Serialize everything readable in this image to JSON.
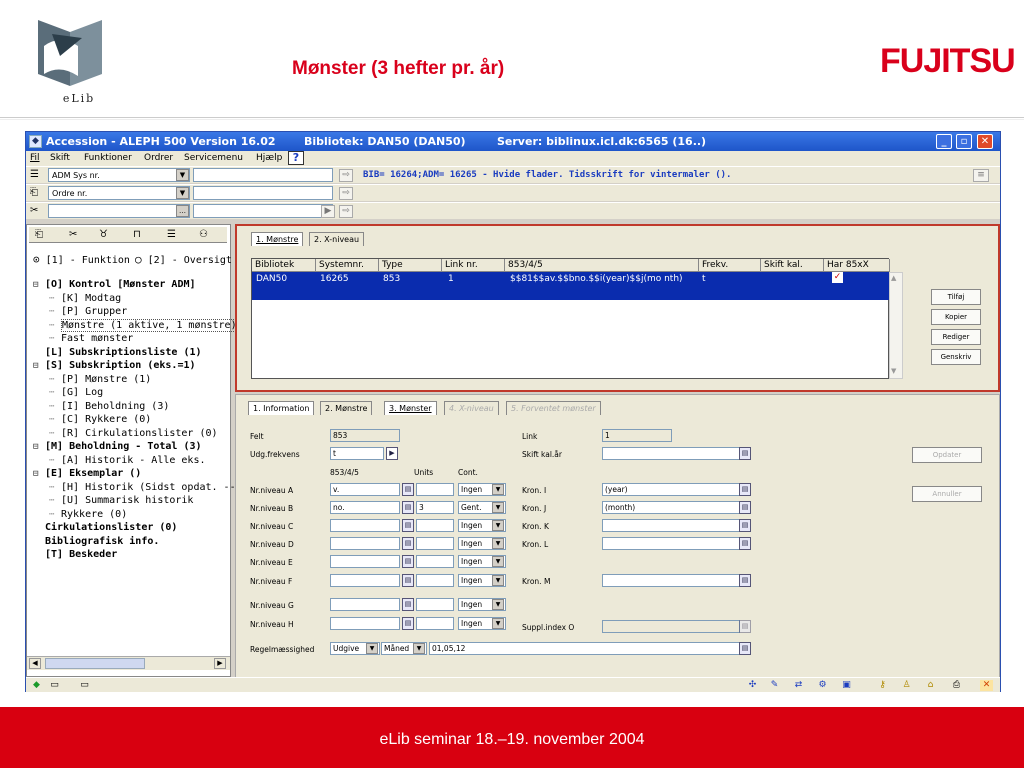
{
  "slide": {
    "title": "Mønster (3 hefter pr. år)",
    "logo_left_text": "eLib",
    "logo_right_text": "FUJITSU",
    "footer": "eLib seminar 18.–19. november 2004"
  },
  "window": {
    "title_app": "Accession - ALEPH 500 Version 16.02",
    "title_lib": "Bibliotek:  DAN50 (DAN50)",
    "title_server": "Server:  biblinux.icl.dk:6565 (16..)",
    "min": "_",
    "max": "▫",
    "close": "✕"
  },
  "menu": [
    "Fil",
    "Skift",
    "Funktioner",
    "Ordrer",
    "Servicemenu",
    "Hjælp",
    "?"
  ],
  "search": {
    "row1_combo": "ADM Sys nr.",
    "row2_combo": "Ordre nr.",
    "row3_combo": "",
    "bib_info": "BIB= 16264;ADM= 16265 - Hvide flader. Tidsskrift for vintermaler ()."
  },
  "left": {
    "radio1": "[1] - Funktion",
    "radio2": "[2] - Oversigt",
    "tree": [
      {
        "text": "[O] Kontrol [Mønster ADM]",
        "bold": true,
        "indent": 0,
        "sign": "⊟"
      },
      {
        "text": "[K] Modtag",
        "bold": false,
        "indent": 1,
        "sign": ""
      },
      {
        "text": "[P] Grupper",
        "bold": false,
        "indent": 1,
        "sign": ""
      },
      {
        "text": "Mønstre (1 aktive, 1 mønstre)",
        "bold": false,
        "indent": 1,
        "sign": "",
        "selected": true
      },
      {
        "text": "Fast mønster",
        "bold": false,
        "indent": 1,
        "sign": ""
      },
      {
        "text": "[L] Subskriptionsliste (1)",
        "bold": true,
        "indent": 0,
        "sign": ""
      },
      {
        "text": "[S] Subskription (eks.=1)",
        "bold": true,
        "indent": 0,
        "sign": "⊟"
      },
      {
        "text": "[P] Mønstre (1)",
        "bold": false,
        "indent": 1,
        "sign": ""
      },
      {
        "text": "[G] Log",
        "bold": false,
        "indent": 1,
        "sign": ""
      },
      {
        "text": "[I] Beholdning (3)",
        "bold": false,
        "indent": 1,
        "sign": ""
      },
      {
        "text": "[C] Rykkere (0)",
        "bold": false,
        "indent": 1,
        "sign": ""
      },
      {
        "text": "[R] Cirkulationslister (0)",
        "bold": false,
        "indent": 1,
        "sign": ""
      },
      {
        "text": "[M] Beholdning - Total (3)",
        "bold": true,
        "indent": 0,
        "sign": "⊟"
      },
      {
        "text": "[A] Historik - Alle eks.",
        "bold": false,
        "indent": 1,
        "sign": ""
      },
      {
        "text": "[E] Eksemplar ()",
        "bold": true,
        "indent": 0,
        "sign": "⊟"
      },
      {
        "text": "[H] Historik (Sidst opdat. -----",
        "bold": false,
        "indent": 1,
        "sign": ""
      },
      {
        "text": "[U] Summarisk historik",
        "bold": false,
        "indent": 1,
        "sign": ""
      },
      {
        "text": "Rykkere (0)",
        "bold": false,
        "indent": 1,
        "sign": ""
      },
      {
        "text": "Cirkulationslister (0)",
        "bold": true,
        "indent": 0,
        "sign": ""
      },
      {
        "text": "Bibliografisk info.",
        "bold": true,
        "indent": 0,
        "sign": ""
      },
      {
        "text": "[T] Beskeder",
        "bold": true,
        "indent": 0,
        "sign": ""
      }
    ]
  },
  "upper": {
    "tabs": [
      "1. Mønstre",
      "2. X-niveau"
    ],
    "columns": [
      "Bibliotek",
      "Systemnr.",
      "Type",
      "Link nr.",
      "853/4/5",
      "Frekv.",
      "Skift kal.",
      "Har 85xX"
    ],
    "row": [
      "DAN50",
      "16265",
      "853",
      "1",
      "$$81$$av.$$bno.$$i(year)$$j(mo nth)",
      "t",
      "",
      "✓"
    ],
    "buttons": [
      "Tilføj",
      "Kopier",
      "Rediger",
      "Genskriv"
    ]
  },
  "lower": {
    "tabs": [
      "1. Information",
      "2. Mønstre",
      "3. Mønster",
      "4. X-niveau",
      "5. Forventet mønster"
    ],
    "felt_label": "Felt",
    "felt_value": "853",
    "link_label": "Link",
    "link_value": "1",
    "udg_label": "Udg.frekvens",
    "udg_value": "t",
    "skift_label": "Skift kal.år",
    "hdr_853": "853/4/5",
    "hdr_units": "Units",
    "hdr_cont": "Cont.",
    "levels": [
      {
        "label": "Nr.niveau A",
        "value": "v.",
        "unit": "",
        "cont": "Ingen"
      },
      {
        "label": "Nr.niveau B",
        "value": "no.",
        "unit": "3",
        "cont": "Gent."
      },
      {
        "label": "Nr.niveau C",
        "value": "",
        "unit": "",
        "cont": "Ingen"
      },
      {
        "label": "Nr.niveau D",
        "value": "",
        "unit": "",
        "cont": "Ingen"
      },
      {
        "label": "Nr.niveau E",
        "value": "",
        "unit": "",
        "cont": "Ingen"
      },
      {
        "label": "Nr.niveau F",
        "value": "",
        "unit": "",
        "cont": "Ingen"
      },
      {
        "label": "Nr.niveau G",
        "value": "",
        "unit": "",
        "cont": "Ingen"
      },
      {
        "label": "Nr.niveau H",
        "value": "",
        "unit": "",
        "cont": "Ingen"
      }
    ],
    "kron": [
      {
        "label": "Kron. I",
        "value": "(year)"
      },
      {
        "label": "Kron. J",
        "value": "(month)"
      },
      {
        "label": "Kron. K",
        "value": ""
      },
      {
        "label": "Kron. L",
        "value": ""
      },
      {
        "label": "Kron. M",
        "value": ""
      }
    ],
    "suppl_label": "Suppl.index O",
    "regel_label": "Regelmæssighed",
    "regel_sel1": "Udgive",
    "regel_sel2": "Måned",
    "regel_value": "01,05,12",
    "btn_update": "Opdater",
    "btn_cancel": "Annuller"
  }
}
